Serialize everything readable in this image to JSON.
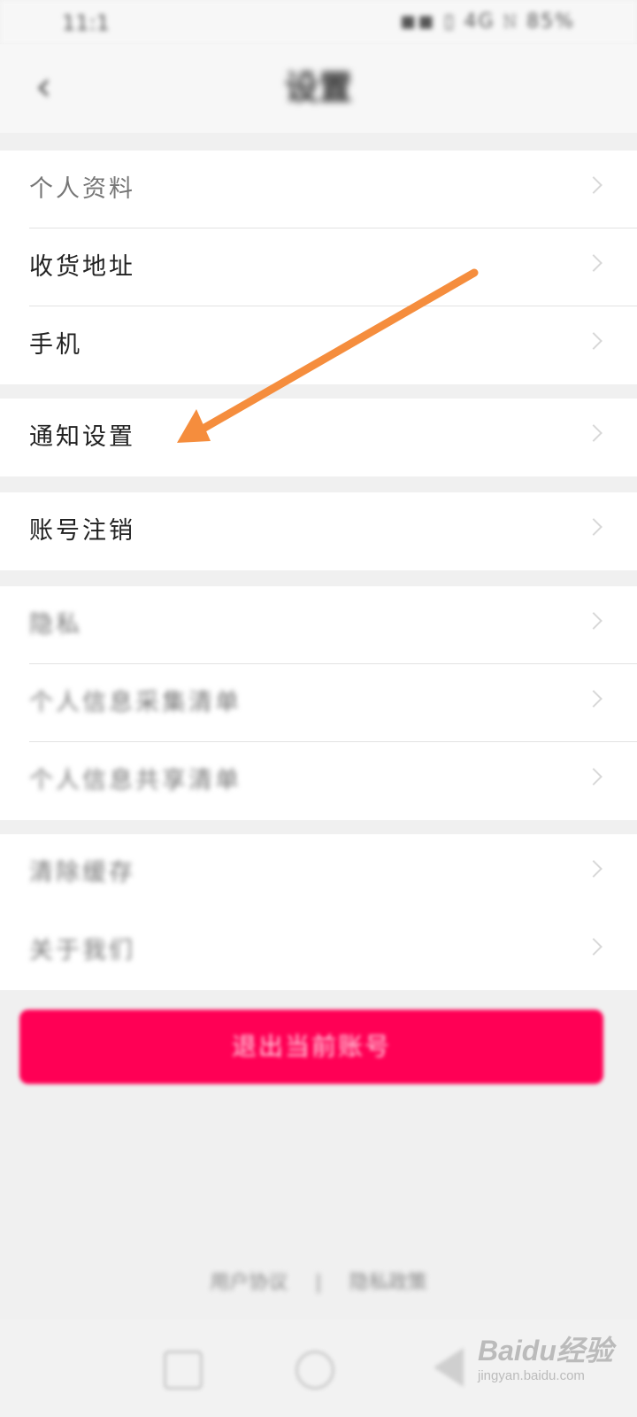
{
  "status_bar": {
    "time": "11:1",
    "icons": "◼◼ ▯ 4G 𝙽 85%"
  },
  "nav": {
    "title": "设置"
  },
  "groups": [
    {
      "items": [
        {
          "label": "个人资料"
        },
        {
          "label": "收货地址"
        },
        {
          "label": "手机"
        }
      ]
    },
    {
      "items": [
        {
          "label": "通知设置"
        }
      ]
    },
    {
      "items": [
        {
          "label": "账号注销"
        }
      ]
    },
    {
      "items": [
        {
          "label": "隐私"
        },
        {
          "label": "个人信息采集清单"
        },
        {
          "label": "个人信息共享清单"
        }
      ]
    },
    {
      "items": [
        {
          "label": "清除缓存"
        },
        {
          "label": "关于我们"
        }
      ]
    }
  ],
  "cta": {
    "label": "退出当前账号"
  },
  "footer": {
    "left": "用户协议",
    "sep": "|",
    "right": "隐私政策"
  },
  "watermark": {
    "brand": "Baidu经验",
    "sub": "jingyan.baidu.com"
  },
  "colors": {
    "accent": "#ff0055",
    "arrow": "#f58d3d",
    "background": "#f0f0f0"
  }
}
